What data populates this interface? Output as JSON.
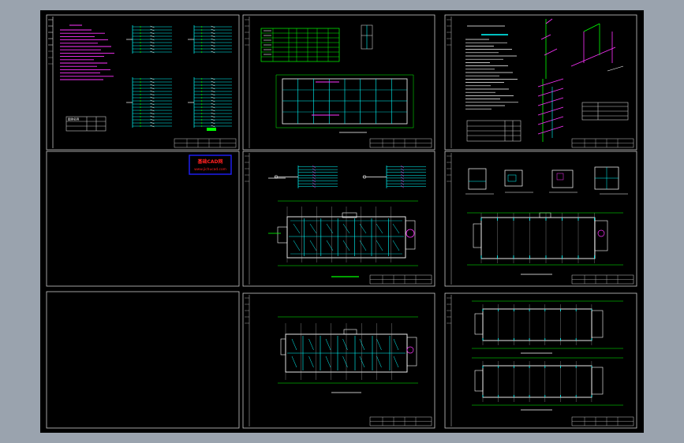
{
  "viewer": {
    "background": "#9aa3ae",
    "model_space": "#000000",
    "frame_color": "#c8c8c8"
  },
  "colors": {
    "cyan": "#00ffff",
    "magenta": "#ff33ff",
    "green": "#00ff00",
    "white": "#ffffff",
    "red": "#ff2020",
    "yellow": "#ffff00",
    "blue": "#2020ff",
    "gray": "#c8c8c8"
  },
  "stamp": {
    "line1": "基础CAD网",
    "line2": "www.jichucad.com"
  },
  "legend_header": "图例名称",
  "sheets": [
    {
      "id": "sheet-1",
      "kind": "electrical-notes"
    },
    {
      "id": "sheet-2",
      "kind": "building-plan-table"
    },
    {
      "id": "sheet-3",
      "kind": "plumbing-notes"
    },
    {
      "id": "sheet-4",
      "kind": "stamp-only"
    },
    {
      "id": "sheet-5",
      "kind": "lighting-plan"
    },
    {
      "id": "sheet-6",
      "kind": "foundation-plan"
    },
    {
      "id": "sheet-7",
      "kind": "blank"
    },
    {
      "id": "sheet-8",
      "kind": "power-plan"
    },
    {
      "id": "sheet-9",
      "kind": "double-plan"
    }
  ]
}
